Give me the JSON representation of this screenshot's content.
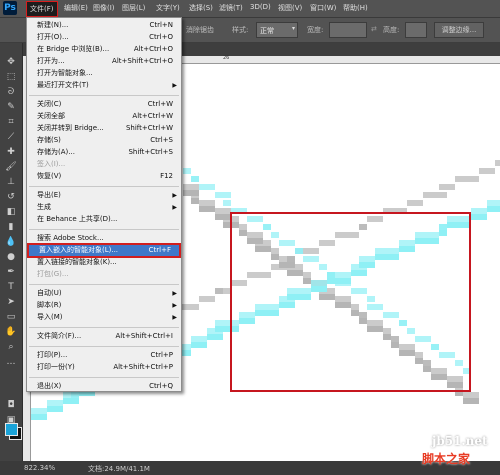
{
  "app": {
    "logo": "Ps"
  },
  "menubar": {
    "items": [
      "文件(F)",
      "编辑(E)",
      "图像(I)",
      "图层(L)",
      "文字(Y)",
      "选择(S)",
      "滤镜(T)",
      "3D(D)",
      "视图(V)",
      "窗口(W)",
      "帮助(H)"
    ]
  },
  "options": {
    "feather_label": "消除锯齿",
    "style_label": "样式:",
    "style_value": "正常",
    "width_label": "宽度:",
    "height_label": "高度:",
    "refine_button": "调整边缘..."
  },
  "ruler": {
    "top_mark": "26"
  },
  "file_menu": {
    "items": [
      {
        "label": "新建(N)...",
        "shortcut": "Ctrl+N"
      },
      {
        "label": "打开(O)...",
        "shortcut": "Ctrl+O"
      },
      {
        "label": "在 Bridge 中浏览(B)...",
        "shortcut": "Alt+Ctrl+O"
      },
      {
        "label": "打开为...",
        "shortcut": "Alt+Shift+Ctrl+O"
      },
      {
        "label": "打开为智能对象...",
        "shortcut": ""
      },
      {
        "label": "最近打开文件(T)",
        "shortcut": "",
        "submenu": true
      },
      {
        "label": "关闭(C)",
        "shortcut": "Ctrl+W"
      },
      {
        "label": "关闭全部",
        "shortcut": "Alt+Ctrl+W"
      },
      {
        "label": "关闭并转到 Bridge...",
        "shortcut": "Shift+Ctrl+W"
      },
      {
        "label": "存储(S)",
        "shortcut": "Ctrl+S"
      },
      {
        "label": "存储为(A)...",
        "shortcut": "Shift+Ctrl+S"
      },
      {
        "label": "签入(I)...",
        "shortcut": "",
        "disabled": true
      },
      {
        "label": "恢复(V)",
        "shortcut": "F12"
      },
      {
        "label": "导出(E)",
        "shortcut": "",
        "submenu": true
      },
      {
        "label": "生成",
        "shortcut": "",
        "submenu": true
      },
      {
        "label": "在 Behance 上共享(D)...",
        "shortcut": ""
      },
      {
        "label": "搜索 Adobe Stock...",
        "shortcut": ""
      },
      {
        "label": "置入嵌入的智能对象(L)...",
        "shortcut": "Ctrl+F",
        "highlighted": true
      },
      {
        "label": "置入链接的智能对象(K)...",
        "shortcut": ""
      },
      {
        "label": "打包(G)...",
        "shortcut": "",
        "disabled": true
      },
      {
        "label": "自动(U)",
        "shortcut": "",
        "submenu": true
      },
      {
        "label": "脚本(R)",
        "shortcut": "",
        "submenu": true
      },
      {
        "label": "导入(M)",
        "shortcut": "",
        "submenu": true
      },
      {
        "label": "文件简介(F)...",
        "shortcut": "Alt+Shift+Ctrl+I"
      },
      {
        "label": "打印(P)...",
        "shortcut": "Ctrl+P"
      },
      {
        "label": "打印一份(Y)",
        "shortcut": "Alt+Shift+Ctrl+P"
      },
      {
        "label": "退出(X)",
        "shortcut": "Ctrl+Q"
      }
    ]
  },
  "status": {
    "zoom": "822.34%",
    "doc_size": "文档:24.9M/41.1M"
  },
  "watermark": {
    "line1": "jb51.net",
    "line2": "脚本之家"
  },
  "colors": {
    "accent_highlight": "#3f78c9",
    "annotation_red": "#d21e1e",
    "cyan_stroke": "#8ff0f5",
    "gray_stroke": "#b5b5b5"
  }
}
